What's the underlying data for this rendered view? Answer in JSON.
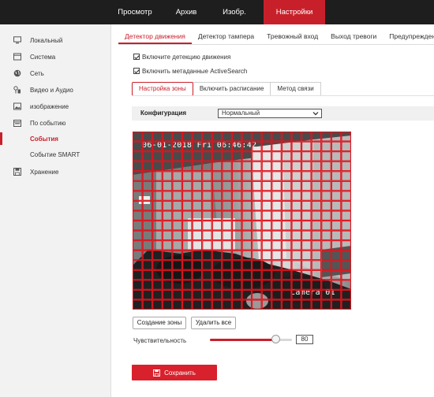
{
  "top_nav": {
    "tabs": [
      {
        "label": "Просмотр",
        "active": false
      },
      {
        "label": "Архив",
        "active": false
      },
      {
        "label": "Изобр.",
        "active": false
      },
      {
        "label": "Настройки",
        "active": true
      }
    ]
  },
  "sidebar": {
    "items": [
      {
        "label": "Локальный",
        "icon": "monitor-icon"
      },
      {
        "label": "Система",
        "icon": "system-icon"
      },
      {
        "label": "Сеть",
        "icon": "network-globe-icon"
      },
      {
        "label": "Видео и Аудио",
        "icon": "video-audio-icon"
      },
      {
        "label": "изображение",
        "icon": "image-icon"
      },
      {
        "label": "По событию",
        "icon": "event-calendar-icon"
      }
    ],
    "sub_items": [
      {
        "label": "События",
        "active": true
      },
      {
        "label": "Событие SMART",
        "active": false
      }
    ],
    "storage": {
      "label": "Хранение",
      "icon": "storage-icon"
    }
  },
  "sub_tabs": [
    {
      "label": "Детектор движения",
      "active": true
    },
    {
      "label": "Детектор тампера",
      "active": false
    },
    {
      "label": "Тревожный вход",
      "active": false
    },
    {
      "label": "Выход тревоги",
      "active": false
    },
    {
      "label": "Предупреждения",
      "active": false
    }
  ],
  "checkboxes": {
    "enable_motion": {
      "label": "Включите детекцию движения",
      "checked": true
    },
    "enable_metadata": {
      "label": "Включить метаданные ActiveSearch",
      "checked": true
    }
  },
  "zone_tabs": [
    {
      "label": "Настройка зоны",
      "active": true
    },
    {
      "label": "Включить расписание",
      "active": false
    },
    {
      "label": "Метод связи",
      "active": false
    }
  ],
  "config": {
    "label": "Конфигурация",
    "selected": "Нормальный"
  },
  "video": {
    "timestamp": "06-01-2018 Fri 06:46:42",
    "camera_name": "Camera 01",
    "grid_color": "#e0141e"
  },
  "buttons": {
    "create_zone": "Создание зоны",
    "delete_all": "Удалить все",
    "save": "Сохранить"
  },
  "sensitivity": {
    "label": "Чувствительность",
    "value": "80",
    "level": 0.8
  },
  "colors": {
    "accent": "#c8202b",
    "topbar": "#1e1e1e"
  }
}
